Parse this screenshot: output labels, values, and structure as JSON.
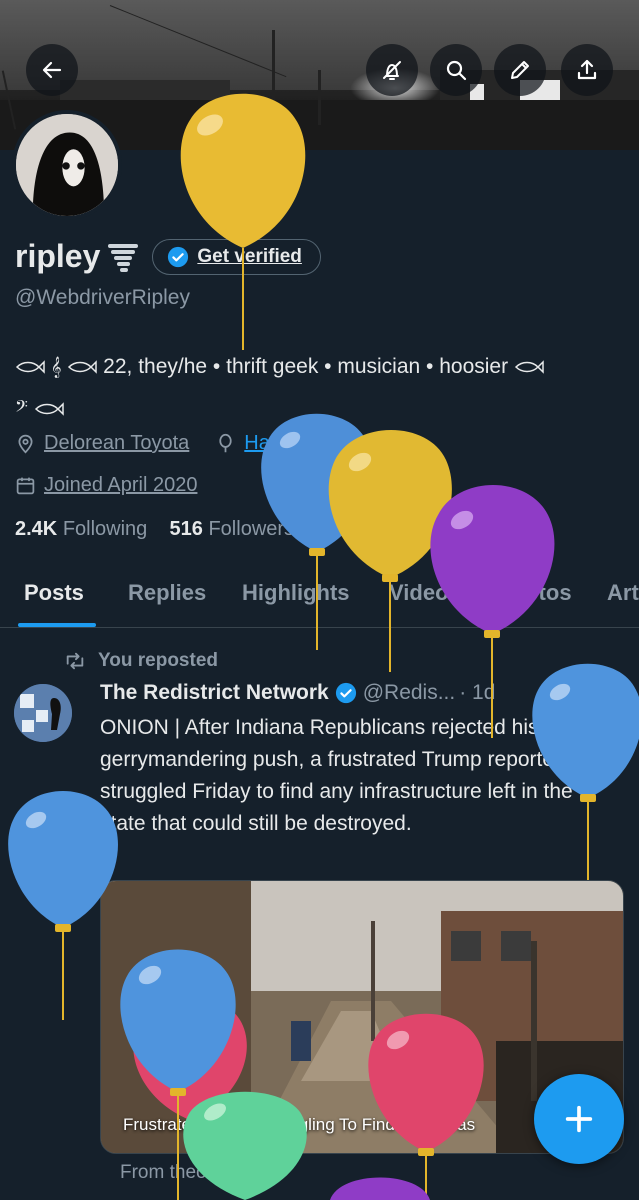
{
  "profile": {
    "name": "ripley",
    "get_verified_label": "Get verified",
    "handle": "@WebdriverRipley",
    "bio_line1": "22, they/he • thrift geek • musician • hoosier",
    "location": "Delorean Toyota",
    "birthday": "Happy birthday!",
    "joined": "Joined April 2020",
    "following_count": "2.4K",
    "following_label": "Following",
    "followers_count": "516",
    "followers_label": "Followers"
  },
  "tabs": [
    "Posts",
    "Replies",
    "Highlights",
    "Videos",
    "Photos",
    "Art"
  ],
  "post": {
    "repost_label": "You reposted",
    "author": "The Redistrict Network",
    "handle": "@Redis...",
    "time": "· 1d",
    "text": "ONION | After Indiana Republicans rejected his gerrymandering push, a frustrated Trump reportedly struggled Friday to find any infrastructure left in the state that could still be destroyed.",
    "media_caption": "Frustrated Trump Struggling To Find Any Infras",
    "source": "From theonion.com"
  },
  "colors": {
    "background": "#15202b",
    "accent": "#1d9bf0",
    "muted": "#8b98a5",
    "divider": "#38444d"
  },
  "icons": {
    "back": "arrow-left-icon",
    "notifications_off": "bell-slash-icon",
    "search": "search-icon",
    "edit": "pencil-icon",
    "share": "share-icon",
    "verified": "verified-badge-icon",
    "location": "location-pin-icon",
    "birthday": "balloon-icon",
    "calendar": "calendar-icon",
    "repost": "repost-icon",
    "compose": "plus-icon"
  }
}
